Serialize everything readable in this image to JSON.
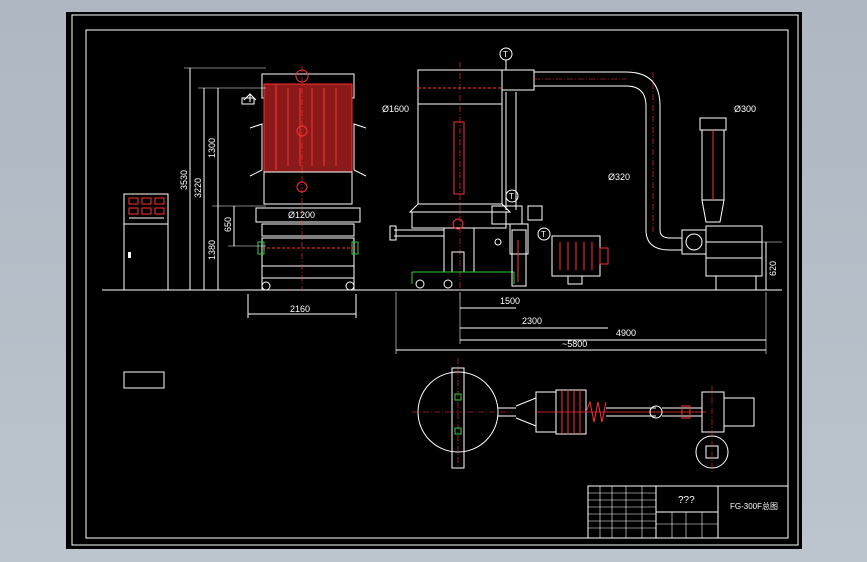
{
  "drawing": {
    "dimensions": {
      "height_total": "3530",
      "height_body": "3220",
      "height_upper": "1300",
      "height_lower": "1380",
      "height_leg": "650",
      "diameter_bed": "Ø1200",
      "width_base": "2160",
      "diameter_filter": "Ø1600",
      "diameter_duct": "Ø320",
      "diameter_cyclone": "Ø300",
      "height_fan": "620",
      "len_1500": "1500",
      "len_2300": "2300",
      "len_4900": "4900",
      "len_5800": "~5800"
    },
    "markers": [
      "T",
      "T",
      "T"
    ],
    "title_block": {
      "title": "???",
      "drawing_no": "FG-300F",
      "drawing_suffix": "总图"
    }
  },
  "colors": {
    "background": "#000000",
    "line_white": "#ffffff",
    "line_red": "#ff3030",
    "fill_red": "#8a1a1a",
    "line_green": "#33cc33",
    "line_yellow": "#e0d040",
    "frame_bg": "#b4bcc6"
  }
}
